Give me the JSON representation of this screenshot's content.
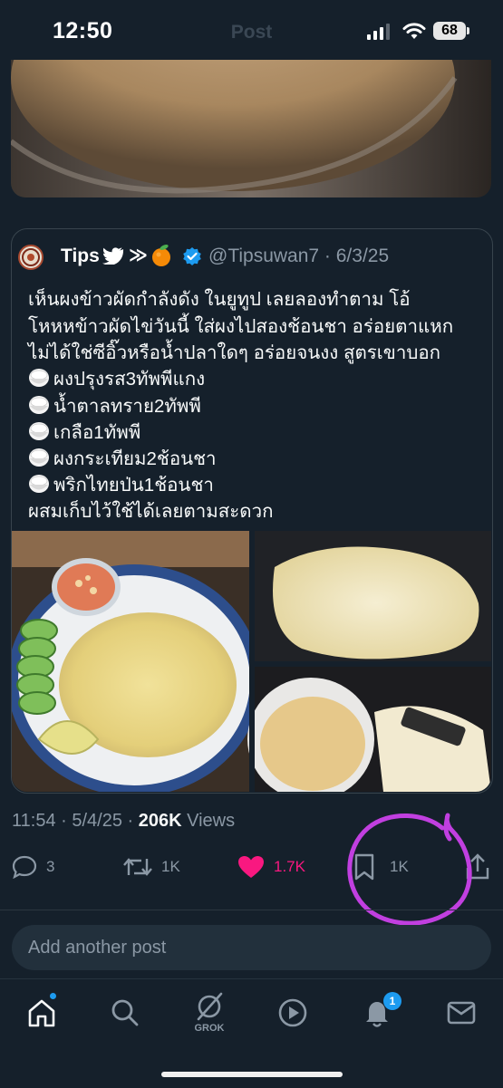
{
  "status_bar": {
    "time": "12:50",
    "ghost_title": "Post",
    "battery": "68"
  },
  "quoted_post": {
    "author_name": "Tips",
    "handle_date": "@Tipsuwan7 · 6/3/25",
    "text_lines": [
      "เห็นผงข้าวผัดกำลังดัง ในยูทูป เลยลองทำตาม โอ้",
      "โหหหข้าวผัดไข่วันนี้ ใส่ผงไปสองช้อนชา อร่อยตาแหก",
      "ไม่ได้ใช่ซีอิ๊วหรือน้ำปลาใดๆ อร่อยจนงง สูตรเขาบอก"
    ],
    "ingredients": [
      "ผงปรุงรส3ทัพพีแกง",
      "น้ำตาลทราย2ทัพพี",
      "เกลือ1ทัพพี",
      "ผงกระเทียม2ช้อนชา",
      "พริกไทยป่น1ช้อนชา"
    ],
    "closing_line": "ผสมเก็บไว้ใช้ได้เลยตามสะดวก"
  },
  "meta": {
    "time_date": "11:54 · 5/4/25 · ",
    "views_count": "206K",
    "views_label": " Views"
  },
  "actions": {
    "replies": "3",
    "reposts": "1K",
    "likes": "1.7K",
    "bookmarks": "1K"
  },
  "composer": {
    "placeholder": "Add another post"
  },
  "tabbar": {
    "grok_label": "GROK",
    "notification_count": "1"
  },
  "colors": {
    "background": "#15202b",
    "like": "#f91880",
    "accent": "#1d9bf0",
    "annotation_circle": "#c13fe0"
  },
  "icons": [
    "reply-icon",
    "repost-icon",
    "heart-icon",
    "bookmark-icon",
    "share-icon",
    "home-icon",
    "search-icon",
    "grok-icon",
    "play-icon",
    "bell-icon",
    "mail-icon"
  ]
}
